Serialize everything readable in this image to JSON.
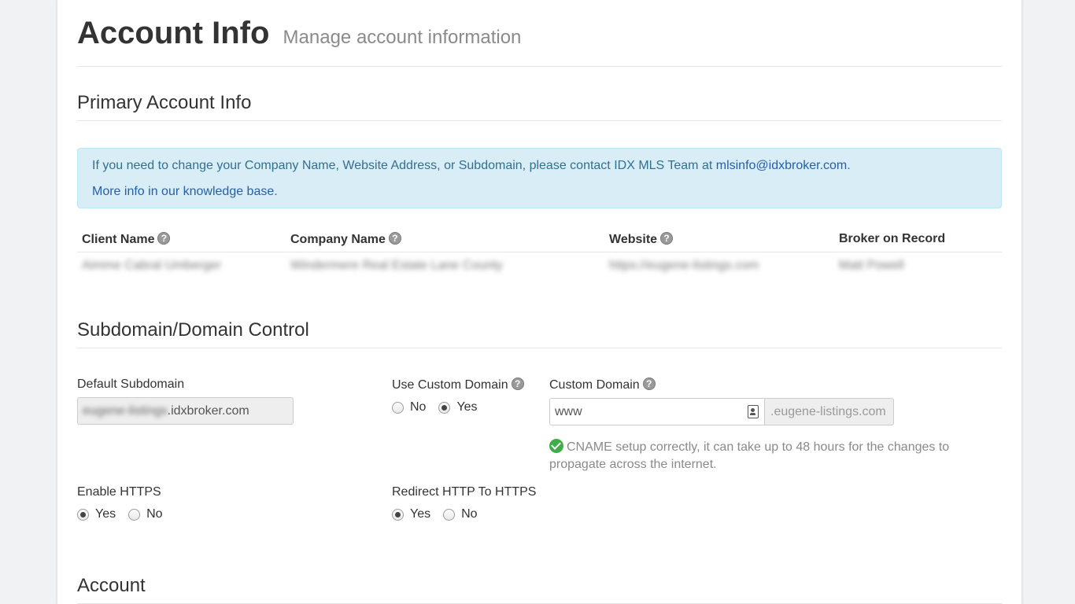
{
  "header": {
    "title": "Account Info",
    "subtitle": "Manage account information"
  },
  "primary": {
    "section_title": "Primary Account Info",
    "alert": {
      "text_before": "If you need to change your Company Name, Website Address, or Subdomain, please contact IDX MLS Team at ",
      "email": "mlsinfo@idxbroker.com",
      "text_after": ".",
      "kb_link": "More info in our knowledge base",
      "kb_after": "."
    },
    "table": {
      "headers": [
        "Client Name",
        "Company Name",
        "Website",
        "Broker on Record"
      ],
      "row": [
        "Aimme Cabral Umberger",
        "Windermere Real Estate Lane County",
        "https://eugene-listings.com",
        "Matt Powell"
      ]
    }
  },
  "domain": {
    "section_title": "Subdomain/Domain Control",
    "default_subdomain": {
      "label": "Default Subdomain",
      "blurred_part": "eugene-listings",
      "suffix": ".idxbroker.com"
    },
    "use_custom_domain": {
      "label": "Use Custom Domain",
      "options": [
        "No",
        "Yes"
      ],
      "selected": "Yes"
    },
    "custom_domain": {
      "label": "Custom Domain",
      "value": "www",
      "addon": ".eugene-listings.com",
      "status": "CNAME setup correctly, it can take up to 48 hours for the changes to propagate across the internet."
    },
    "enable_https": {
      "label": "Enable HTTPS",
      "options": [
        "Yes",
        "No"
      ],
      "selected": "Yes"
    },
    "redirect_https": {
      "label": "Redirect HTTP To HTTPS",
      "options": [
        "Yes",
        "No"
      ],
      "selected": "Yes"
    }
  },
  "account": {
    "section_title": "Account"
  },
  "icons": {
    "help": "?",
    "help_icon": "question-circle-icon",
    "check_icon": "check-circle-icon",
    "contact_icon": "contact-card-icon"
  },
  "colors": {
    "alert_bg": "#d9edf7",
    "alert_text": "#31708f",
    "link": "#245fa8",
    "success": "#3fae49"
  }
}
